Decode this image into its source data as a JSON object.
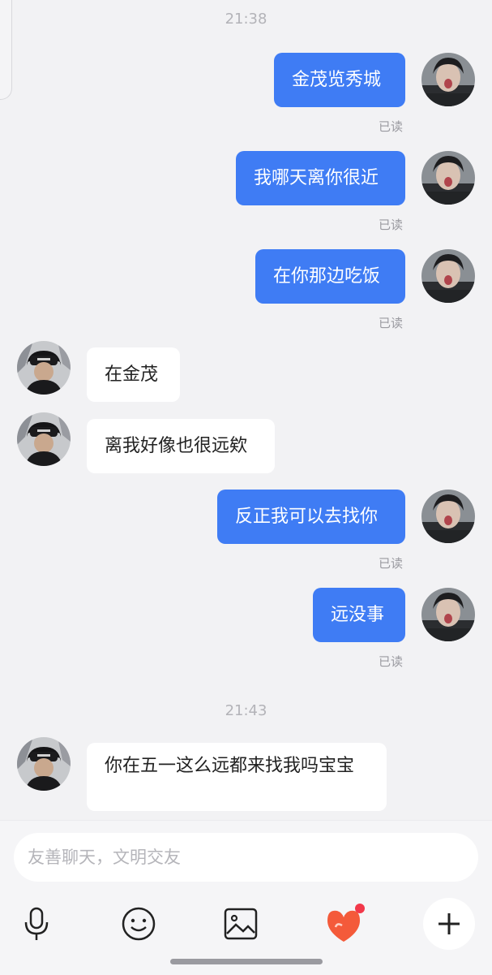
{
  "timestamps": [
    "21:38",
    "21:43"
  ],
  "read_label": "已读",
  "messages": [
    {
      "sender": "me",
      "text": "金茂览秀城",
      "read": "已读"
    },
    {
      "sender": "me",
      "text": "我哪天离你很近",
      "read": "已读"
    },
    {
      "sender": "me",
      "text": "在你那边吃饭",
      "read": "已读"
    },
    {
      "sender": "them",
      "text": "在金茂"
    },
    {
      "sender": "them",
      "text": "离我好像也很远欸"
    },
    {
      "sender": "me",
      "text": "反正我可以去找你",
      "read": "已读"
    },
    {
      "sender": "me",
      "text": "远没事",
      "read": "已读"
    },
    {
      "sender": "them",
      "text": "你在五一这么远都来找我吗宝宝"
    }
  ],
  "input": {
    "placeholder": "友善聊天，文明交友"
  },
  "toolbar": [
    "microphone-icon",
    "emoji-icon",
    "image-icon",
    "heart-gift-icon",
    "plus-icon"
  ],
  "colors": {
    "my_bubble": "#3f7cf4",
    "their_bubble": "#ffffff",
    "background": "#f2f2f4",
    "gift": "#f45a3a"
  }
}
